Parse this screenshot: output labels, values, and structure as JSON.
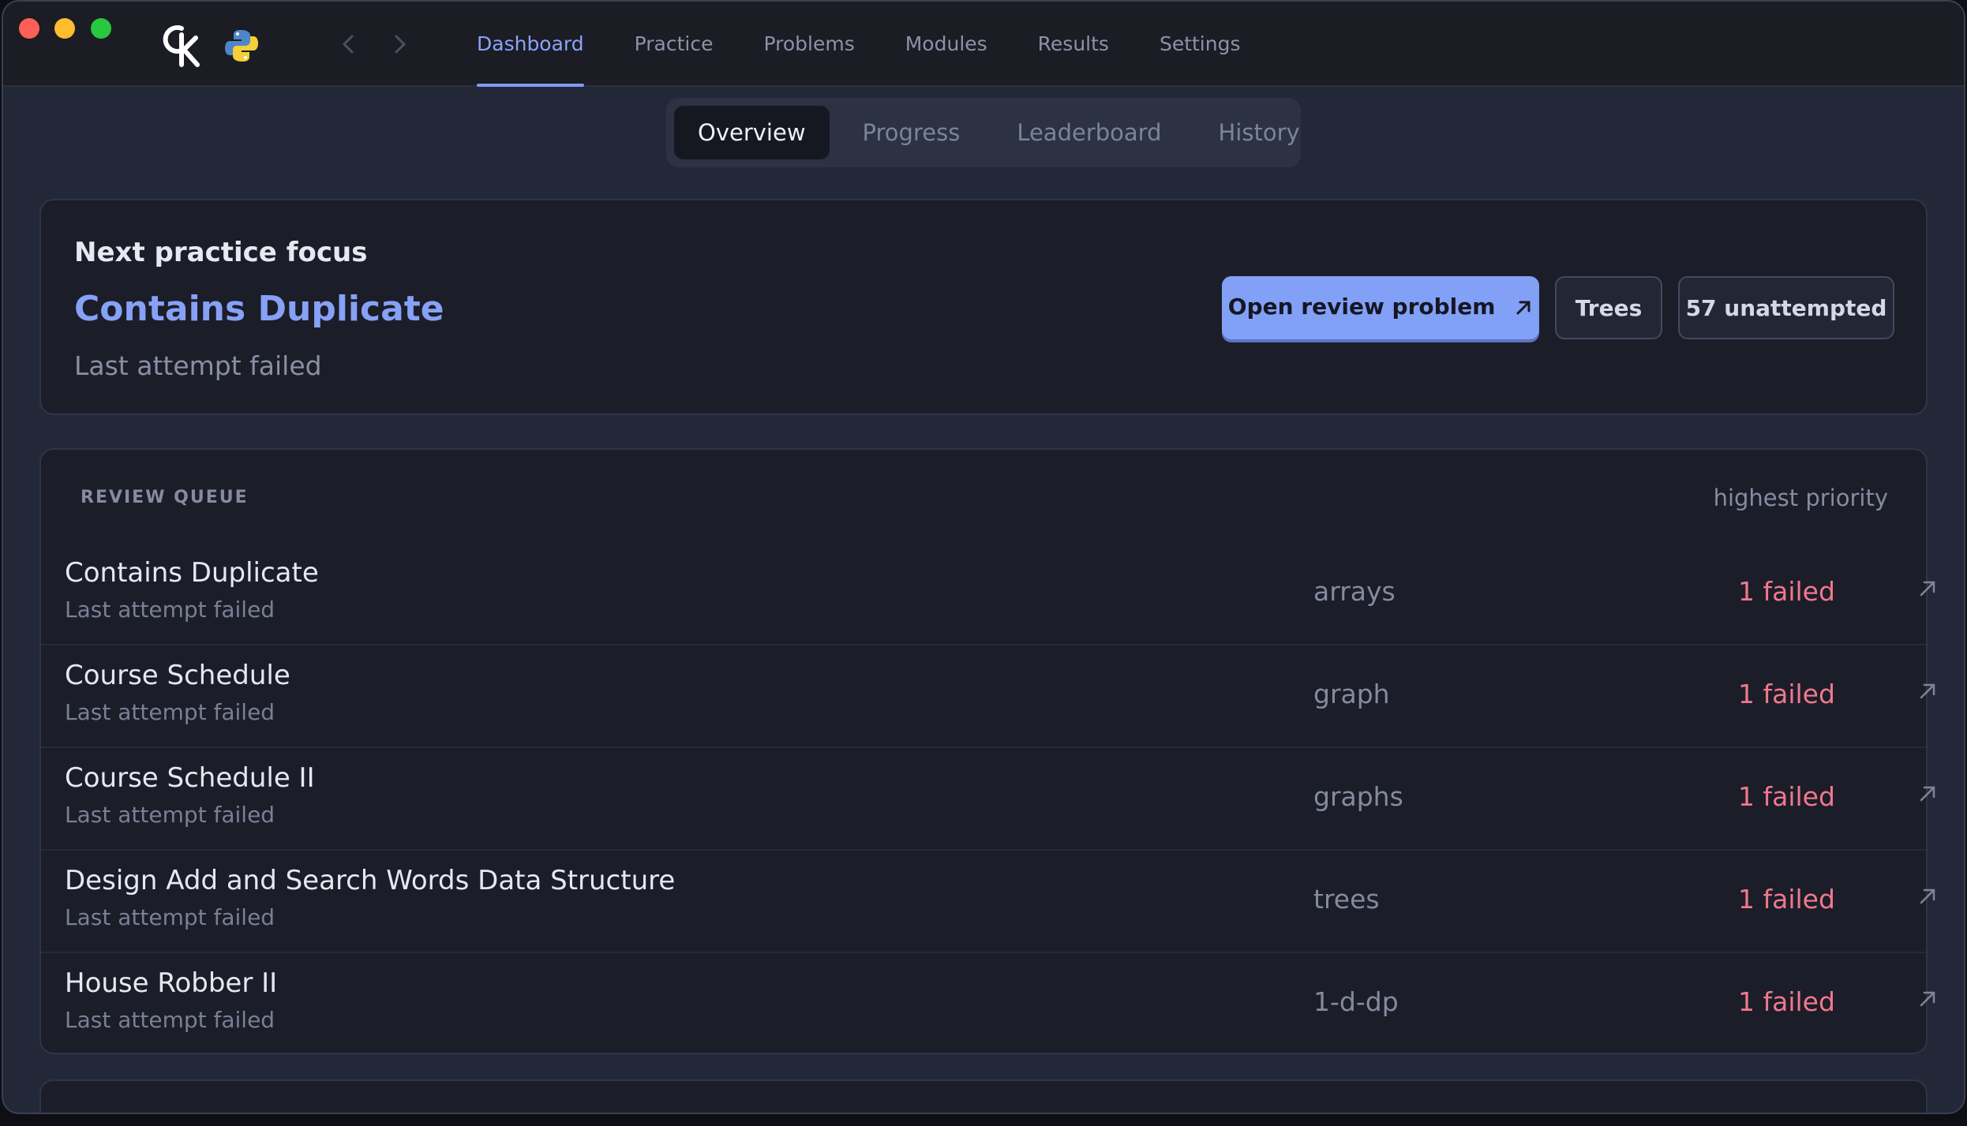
{
  "nav": {
    "tabs": [
      {
        "label": "Dashboard",
        "active": true
      },
      {
        "label": "Practice"
      },
      {
        "label": "Problems"
      },
      {
        "label": "Modules"
      },
      {
        "label": "Results"
      },
      {
        "label": "Settings"
      }
    ]
  },
  "segment": {
    "tabs": [
      {
        "label": "Overview",
        "active": true
      },
      {
        "label": "Progress"
      },
      {
        "label": "Leaderboard"
      },
      {
        "label": "History"
      }
    ]
  },
  "focus": {
    "kicker": "Next practice focus",
    "title": "Contains Duplicate",
    "subtitle": "Last attempt failed",
    "primary_button": "Open review problem",
    "tag_button": "Trees",
    "count_button": "57 unattempted"
  },
  "queue": {
    "heading": "REVIEW QUEUE",
    "priority": "highest priority",
    "rows": [
      {
        "title": "Contains Duplicate",
        "subtitle": "Last attempt failed",
        "tag": "arrays",
        "status": "1 failed"
      },
      {
        "title": "Course Schedule",
        "subtitle": "Last attempt failed",
        "tag": "graph",
        "status": "1 failed"
      },
      {
        "title": "Course Schedule II",
        "subtitle": "Last attempt failed",
        "tag": "graphs",
        "status": "1 failed"
      },
      {
        "title": "Design Add and Search Words Data Structure",
        "subtitle": "Last attempt failed",
        "tag": "trees",
        "status": "1 failed"
      },
      {
        "title": "House Robber II",
        "subtitle": "Last attempt failed",
        "tag": "1-d-dp",
        "status": "1 failed"
      }
    ]
  },
  "colors": {
    "accent": "#82a0f6",
    "failed": "#f0788d",
    "background": "#232839",
    "card": "#1b1d29"
  }
}
